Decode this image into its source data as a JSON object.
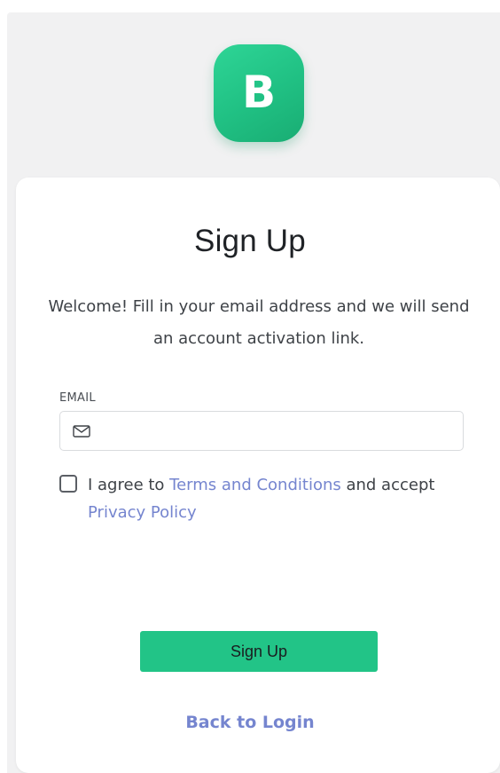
{
  "logo": {
    "letter": "B",
    "color": "#22c487"
  },
  "form": {
    "title": "Sign Up",
    "subtitle": "Welcome! Fill in your email address and we will send an account activation link.",
    "email": {
      "label": "EMAIL",
      "value": "",
      "placeholder": "",
      "icon": "mail-icon"
    },
    "agreement": {
      "checked": false,
      "text_1": "I agree to ",
      "terms_link": "Terms and Conditions",
      "text_2": " and accept ",
      "privacy_link": "Privacy Policy"
    },
    "submit_label": "Sign Up",
    "back_link": "Back to Login"
  },
  "colors": {
    "accent": "#22c487",
    "link": "#7585cf"
  }
}
